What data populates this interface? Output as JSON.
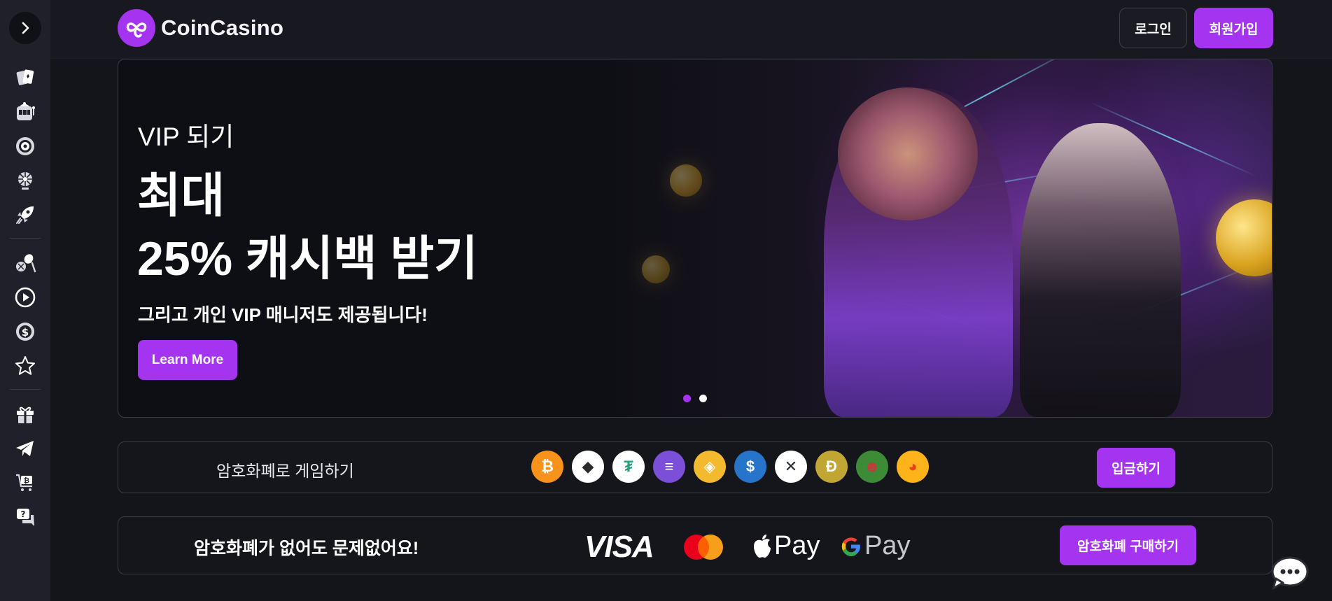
{
  "header": {
    "logo_text": "CoinCasino",
    "login_label": "로그인",
    "signup_label": "회원가입"
  },
  "sidebar": {
    "toggle_icon": "chevron-right-icon",
    "groups": [
      [
        "cards-icon",
        "slot-machine-icon",
        "roulette-icon",
        "wheel-icon",
        "rocket-icon"
      ],
      [
        "sports-icon",
        "play-icon",
        "dollar-chip-icon",
        "star-icon"
      ],
      [
        "gift-icon",
        "telegram-icon",
        "bitcoin-cart-icon",
        "help-chat-icon"
      ]
    ]
  },
  "hero": {
    "eyebrow": "VIP 되기",
    "title_line1": "최대",
    "title_line2": "25% 캐시백 받기",
    "subtitle": "그리고 개인 VIP 매니저도 제공됩니다!",
    "cta_label": "Learn More",
    "slides": 2,
    "active_slide": 1
  },
  "crypto_bar": {
    "label": "암호화폐로 게임하기",
    "coins": [
      {
        "name": "bitcoin-icon",
        "glyph": "₿",
        "bg": "#f7931a",
        "fg": "#ffffff"
      },
      {
        "name": "ethereum-icon",
        "glyph": "◆",
        "bg": "#ffffff",
        "fg": "#2b2b2b"
      },
      {
        "name": "tether-icon",
        "glyph": "₮",
        "bg": "#ffffff",
        "fg": "#26a17b"
      },
      {
        "name": "solana-icon",
        "glyph": "≡",
        "bg": "#7b4fd8",
        "fg": "#ffffff"
      },
      {
        "name": "bnb-icon",
        "glyph": "◈",
        "bg": "#f3ba2f",
        "fg": "#ffffff"
      },
      {
        "name": "usdc-icon",
        "glyph": "$",
        "bg": "#2775ca",
        "fg": "#ffffff"
      },
      {
        "name": "xrp-icon",
        "glyph": "✕",
        "bg": "#ffffff",
        "fg": "#23292f"
      },
      {
        "name": "dogecoin-icon",
        "glyph": "Ð",
        "bg": "#c2a633",
        "fg": "#ffffff"
      },
      {
        "name": "pepe-icon",
        "glyph": "☻",
        "bg": "#3d8b37",
        "fg": "#c33b3b"
      },
      {
        "name": "shiba-icon",
        "glyph": "◕",
        "bg": "#ffb31a",
        "fg": "#e8411b"
      }
    ],
    "deposit_label": "입금하기"
  },
  "pay_bar": {
    "label": "암호화폐가 없어도 문제없어요!",
    "visa": "VISA",
    "apple_pay": "Pay",
    "google_pay": "Pay",
    "buy_label": "암호화폐 구매하기"
  },
  "colors": {
    "accent": "#a534f0",
    "background": "#14151b",
    "sidebar": "#1f2029",
    "border": "#3a3b45"
  }
}
